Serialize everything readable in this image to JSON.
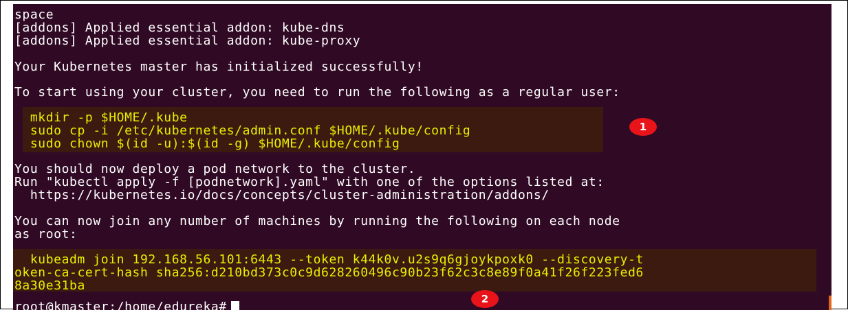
{
  "terminal": {
    "lines": {
      "l0": "space",
      "l1": "[addons] Applied essential addon: kube-dns",
      "l2": "[addons] Applied essential addon: kube-proxy",
      "l3": "Your Kubernetes master has initialized successfully!",
      "l4": "To start using your cluster, you need to run the following as a regular user:",
      "l5": "  mkdir -p $HOME/.kube",
      "l6": "  sudo cp -i /etc/kubernetes/admin.conf $HOME/.kube/config",
      "l7": "  sudo chown $(id -u):$(id -g) $HOME/.kube/config",
      "l8": "You should now deploy a pod network to the cluster.",
      "l9": "Run \"kubectl apply -f [podnetwork].yaml\" with one of the options listed at:",
      "l10": "  https://kubernetes.io/docs/concepts/cluster-administration/addons/",
      "l11": "You can now join any number of machines by running the following on each node",
      "l12": "as root:",
      "l13": "  kubeadm join 192.168.56.101:6443 --token k44k0v.u2s9q6gjoykpoxk0 --discovery-t",
      "l14": "oken-ca-cert-hash sha256:d210bd373c0c9d628260496c90b23f62c3c8e89f0a41f26f223fed6",
      "l15": "8a30e31ba",
      "prompt": "root@kmaster:/home/edureka#"
    },
    "colors": {
      "background": "#300a24",
      "text": "#ffffff",
      "highlight_text": "#e8f000",
      "highlight_bg": "#3d1a10",
      "badge": "#e8141a"
    }
  },
  "annotations": {
    "badge_1": "1",
    "badge_2": "2"
  }
}
